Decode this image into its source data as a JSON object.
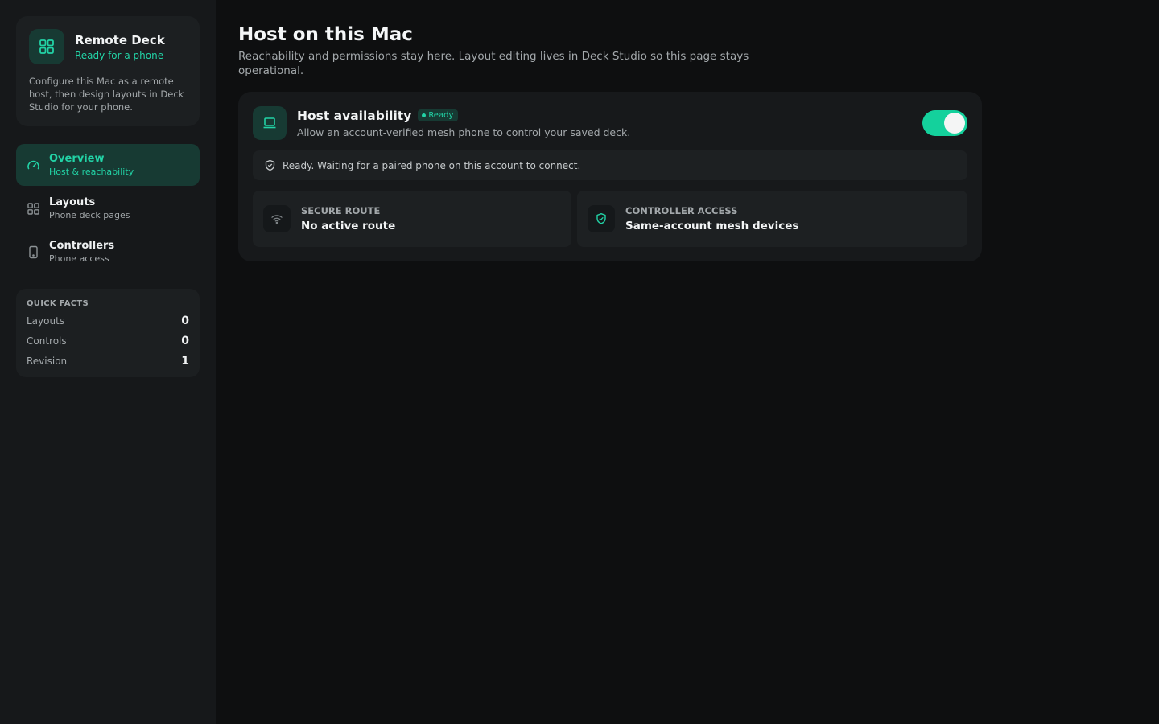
{
  "colors": {
    "accent": "#22d3a6",
    "toggle_on": "#14d19c",
    "background": "#0e0f10",
    "sidebar": "#16181a"
  },
  "brand": {
    "icon": "grid-icon",
    "title": "Remote Deck",
    "subtitle": "Ready for a phone",
    "description": "Configure this Mac as a remote host, then design layouts in Deck Studio for your phone."
  },
  "nav": {
    "items": [
      {
        "icon": "gauge-icon",
        "label": "Overview",
        "sub": "Host & reachability",
        "active": true
      },
      {
        "icon": "grid-icon",
        "label": "Layouts",
        "sub": "Phone deck pages",
        "active": false
      },
      {
        "icon": "phone-icon",
        "label": "Controllers",
        "sub": "Phone access",
        "active": false
      }
    ]
  },
  "quick_facts": {
    "title": "QUICK FACTS",
    "rows": [
      {
        "label": "Layouts",
        "value": "0"
      },
      {
        "label": "Controls",
        "value": "0"
      },
      {
        "label": "Revision",
        "value": "1"
      }
    ]
  },
  "main": {
    "title": "Host on this Mac",
    "subtitle": "Reachability and permissions stay here. Layout editing lives in Deck Studio so this page stays operational."
  },
  "host_card": {
    "icon": "laptop-icon",
    "title": "Host availability",
    "badge": "Ready",
    "subtitle": "Allow an account-verified mesh phone to control your saved deck.",
    "toggle_on": true,
    "status_icon": "shield-icon",
    "status": "Ready. Waiting for a paired phone on this account to connect.",
    "tiles": [
      {
        "icon": "wifi-icon",
        "label": "SECURE ROUTE",
        "value": "No active route"
      },
      {
        "icon": "shield-check-icon",
        "label": "CONTROLLER ACCESS",
        "value": "Same-account mesh devices"
      }
    ]
  }
}
